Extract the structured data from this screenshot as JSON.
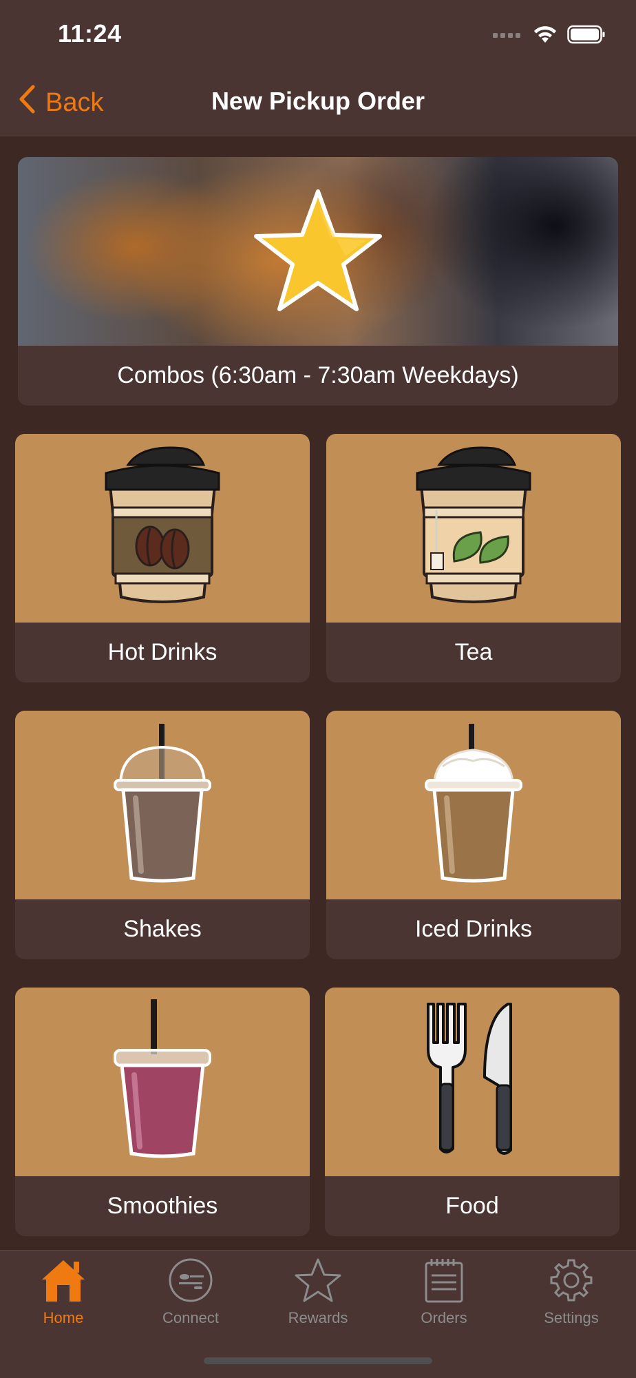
{
  "status_bar": {
    "time": "11:24"
  },
  "nav": {
    "back_label": "Back",
    "title": "New Pickup Order"
  },
  "combo": {
    "label": "Combos (6:30am - 7:30am Weekdays)"
  },
  "categories": [
    {
      "label": "Hot Drinks",
      "icon": "coffee-cup-icon"
    },
    {
      "label": "Tea",
      "icon": "tea-cup-icon"
    },
    {
      "label": "Shakes",
      "icon": "shake-icon"
    },
    {
      "label": "Iced Drinks",
      "icon": "iced-drink-icon"
    },
    {
      "label": "Smoothies",
      "icon": "smoothie-icon"
    },
    {
      "label": "Food",
      "icon": "fork-knife-icon"
    }
  ],
  "tabs": [
    {
      "label": "Home",
      "icon": "home-icon",
      "active": true
    },
    {
      "label": "Connect",
      "icon": "connect-logo-icon",
      "active": false
    },
    {
      "label": "Rewards",
      "icon": "star-icon",
      "active": false
    },
    {
      "label": "Orders",
      "icon": "notepad-icon",
      "active": false
    },
    {
      "label": "Settings",
      "icon": "gear-icon",
      "active": false
    }
  ],
  "colors": {
    "accent": "#f07a12",
    "card_image_bg": "#c18f55",
    "card_label_bg": "#4a3532",
    "page_bg": "#3d2824"
  }
}
